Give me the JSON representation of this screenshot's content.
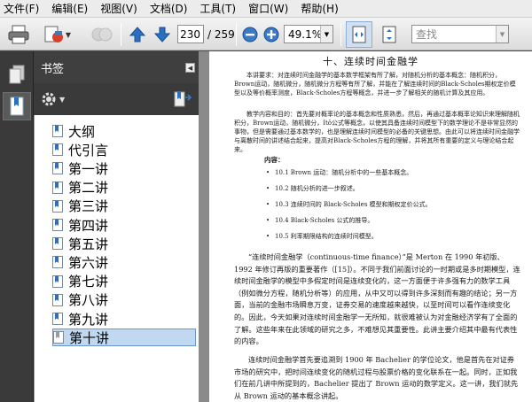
{
  "menu": [
    "文件(F)",
    "编辑(E)",
    "视图(V)",
    "文档(D)",
    "工具(T)",
    "窗口(W)",
    "帮助(H)"
  ],
  "toolbar": {
    "current_page": "230",
    "total_pages": "/ 259",
    "zoom": "49.1%",
    "search_placeholder": "查找"
  },
  "panel": {
    "title": "书签",
    "bookmarks": [
      {
        "label": "大纲",
        "selected": false
      },
      {
        "label": "代引言",
        "selected": false
      },
      {
        "label": "第一讲",
        "selected": false
      },
      {
        "label": "第二讲",
        "selected": false
      },
      {
        "label": "第三讲",
        "selected": false
      },
      {
        "label": "第四讲",
        "selected": false
      },
      {
        "label": "第五讲",
        "selected": false
      },
      {
        "label": "第六讲",
        "selected": false
      },
      {
        "label": "第七讲",
        "selected": false
      },
      {
        "label": "第八讲",
        "selected": false
      },
      {
        "label": "第九讲",
        "selected": false
      },
      {
        "label": "第十讲",
        "selected": true
      }
    ]
  },
  "document": {
    "title": "十、连续时间金融学",
    "para1": "本讲要求：对连续时间金融学的基本数学框架有所了解，对随机分析的基本概念：随机积分，Brown运动，随机微分，随机微分方程等有所了解，并能在了解连续时间的Black-Scholes期权定价模型以及等价概率测度，Black-Scholes方程等概念，并进一步了解相关的随机计算及其应用。",
    "para2": "教学内容和目的：首先要对概率论的基本概念和性质熟悉，然后，再通过基本概率论知识来理解随机积分，Brown运动，随机微分，Itô公式等概念，以使其具备连续时间模型下的数学理论不是非常显然的事物，但是需要通过基本数学的，也是理解连续时间模型的必备的关键思想。由此可以将连续时间金融学与离散时间的讲述结合起来，提高对Black-Scholes方程的理解，并将其所有重要的定义与理论结合起来。",
    "contents_label": "内容：",
    "items": [
      "10.1 Brown 运动：随机分析中的一些基本概念。",
      "10.2 随机分析的进一步叙述。",
      "10.3 连续时间的 Black-Scholes 模型和期权定价公式。",
      "10.4 Black-Scholes 公式的推导。",
      "10.5 利率期限结构的连续时间模型。"
    ],
    "para3": "“连续时间金融学（continuous-time finance）”是 Merton 在 1990 年初版、1992 年修订再版的重要著作（[15]）。不同于我们前面讨论的一时期或是多时期模型，连续时间金融学的模型中多假定时间是连续变化的，这一方面便于许多强有力的数学工具（例如微分方程，随机分析等）的应用，从中又可以得到许多深刻而有趣的结论；另一方面，当前的金融市场瞬息万变，证券交易的速度越来越快，以至时间可以看作连续变化的。因此，今天如果对连续时间金融学一无所知，就很难被认为对金融经济学有了全面的了解。这些年来在此领域的研究之多，不难想见其重要性。此讲主要介绍其中最有代表性的内容。",
    "para4": "连续时间金融学首先要追溯到 1900 年 Bachelier 的学位论文，他是首先在对证券市场的研究中，把时间连续变化的随机过程与股票价格的变化联系在一起。同时，正如我们在前几讲中所提到的，Bachelier 提出了 Brown 运动的数学定义。这一讲，我们就先从 Brown 运动的基本概念讲起。"
  },
  "colors": {
    "accent_blue": "#2a6fc0",
    "panel_dark": "#3a3a3a",
    "selection": "#c0d8f0"
  }
}
